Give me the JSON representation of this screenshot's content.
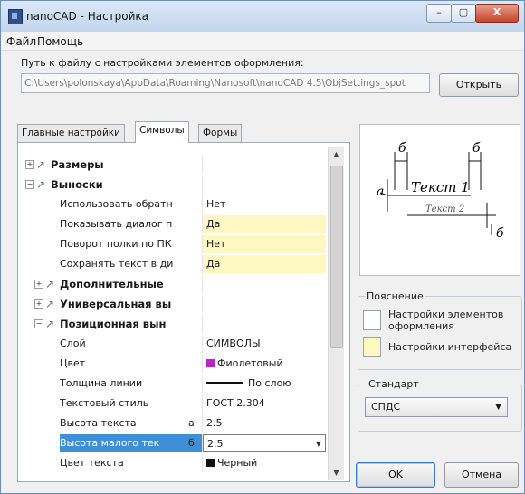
{
  "window": {
    "title": "nanoCAD - Настройка",
    "controls": {
      "minimize": "–",
      "maximize": "▢",
      "close": "X"
    }
  },
  "menu": [
    "Файл",
    "Помощь"
  ],
  "path": {
    "label": "Путь к файлу с настройками элементов оформления:",
    "value": "C:\\Users\\polonskaya\\AppData\\Roaming\\Nanosoft\\nanoCAD 4.5\\ObjSettings_spot",
    "open_button": "Открыть"
  },
  "tabs": [
    "Главные настройки",
    "Символы",
    "Формы"
  ],
  "active_tab": 1,
  "grid": {
    "rows": [
      {
        "name": "Размеры",
        "value": "",
        "expand": "+",
        "icon": "dimension-icon",
        "bold": true
      },
      {
        "name": "Выноски",
        "value": "",
        "expand": "−",
        "icon": "leader-icon",
        "bold": true
      },
      {
        "name": "Использовать обратн",
        "value": "Нет"
      },
      {
        "name": "Показывать диалог п",
        "value": "Да",
        "highlight": true
      },
      {
        "name": "Поворот полки по ПК",
        "value": "Нет",
        "highlight": true
      },
      {
        "name": "Сохранять текст в ди",
        "value": "Да",
        "highlight": true
      },
      {
        "name": "Дополнительные",
        "value": "",
        "expand": "+",
        "icon": "leader-icon",
        "bold": true
      },
      {
        "name": "Универсальная вы",
        "value": "",
        "expand": "+",
        "icon": "leader-icon",
        "bold": true
      },
      {
        "name": "Позиционная вын",
        "value": "",
        "expand": "−",
        "icon": "leader-icon",
        "bold": true
      },
      {
        "name": "Слой",
        "value": "СИМВОЛЫ"
      },
      {
        "name": "Цвет",
        "value": "Фиолетовый",
        "swatch": "#c21fc9"
      },
      {
        "name": "Толщина линии",
        "value": "По слою",
        "line": true
      },
      {
        "name": "Текстовый стиль",
        "value": "ГОСТ 2.304"
      },
      {
        "name": "Высота текста",
        "value": "2.5",
        "letter": "а"
      },
      {
        "name": "Высота малого тек",
        "value": "2.5",
        "letter": "б",
        "selected": true
      },
      {
        "name": "Цвет текста",
        "value": "Черный",
        "swatch": "#111111"
      }
    ]
  },
  "preview": {
    "text1": "Текст 1",
    "text2": "Текст 2",
    "letters": [
      "а",
      "б",
      "б",
      "б"
    ]
  },
  "legend": {
    "title": "Пояснение",
    "items": [
      {
        "text": "Настройки элементов оформления",
        "color": "#ffffff"
      },
      {
        "text": "Настройки интерфейса",
        "color": "#fdf7c2"
      }
    ]
  },
  "standard": {
    "title": "Стандарт",
    "value": "СПДС"
  },
  "buttons": {
    "ok": "OK",
    "cancel": "Отмена"
  }
}
